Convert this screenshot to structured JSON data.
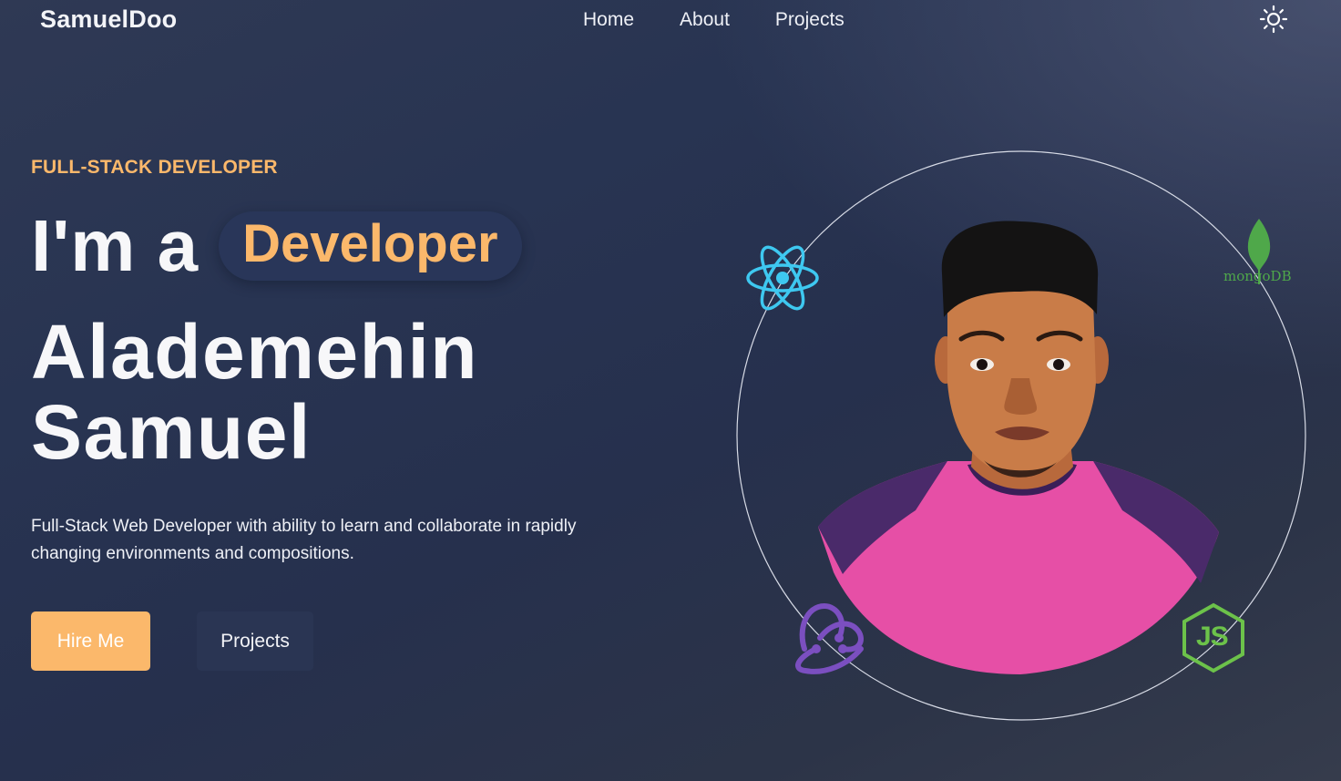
{
  "nav": {
    "logo": "SamuelDoo",
    "links": [
      {
        "label": "Home"
      },
      {
        "label": "About"
      },
      {
        "label": "Projects"
      }
    ],
    "theme_toggle_icon": "sun-icon"
  },
  "hero": {
    "eyebrow": "FULL-STACK DEVELOPER",
    "prefix": "I'm a",
    "role": "Developer",
    "name_line1": "Alademehin",
    "name_line2": "Samuel",
    "bio": "Full-Stack Web Developer with ability to learn and collaborate in rapidly changing environments and compositions.",
    "hire_button": "Hire Me",
    "projects_button": "Projects"
  },
  "tech_icons": {
    "react": "react-icon",
    "mongodb": "mongodb-icon",
    "mongodb_label": "mongoDB",
    "redux": "redux-icon",
    "nodejs": "nodejs-icon",
    "nodejs_label": "JS"
  },
  "colors": {
    "accent": "#fbb86b",
    "background": "#283452",
    "pill": "#293659",
    "secondary_button": "#2a3553",
    "react": "#3ec8f0",
    "mongodb": "#4fa84a",
    "redux": "#7b4fc0",
    "nodejs": "#6cc24a",
    "shirt": "#e64fa6"
  }
}
